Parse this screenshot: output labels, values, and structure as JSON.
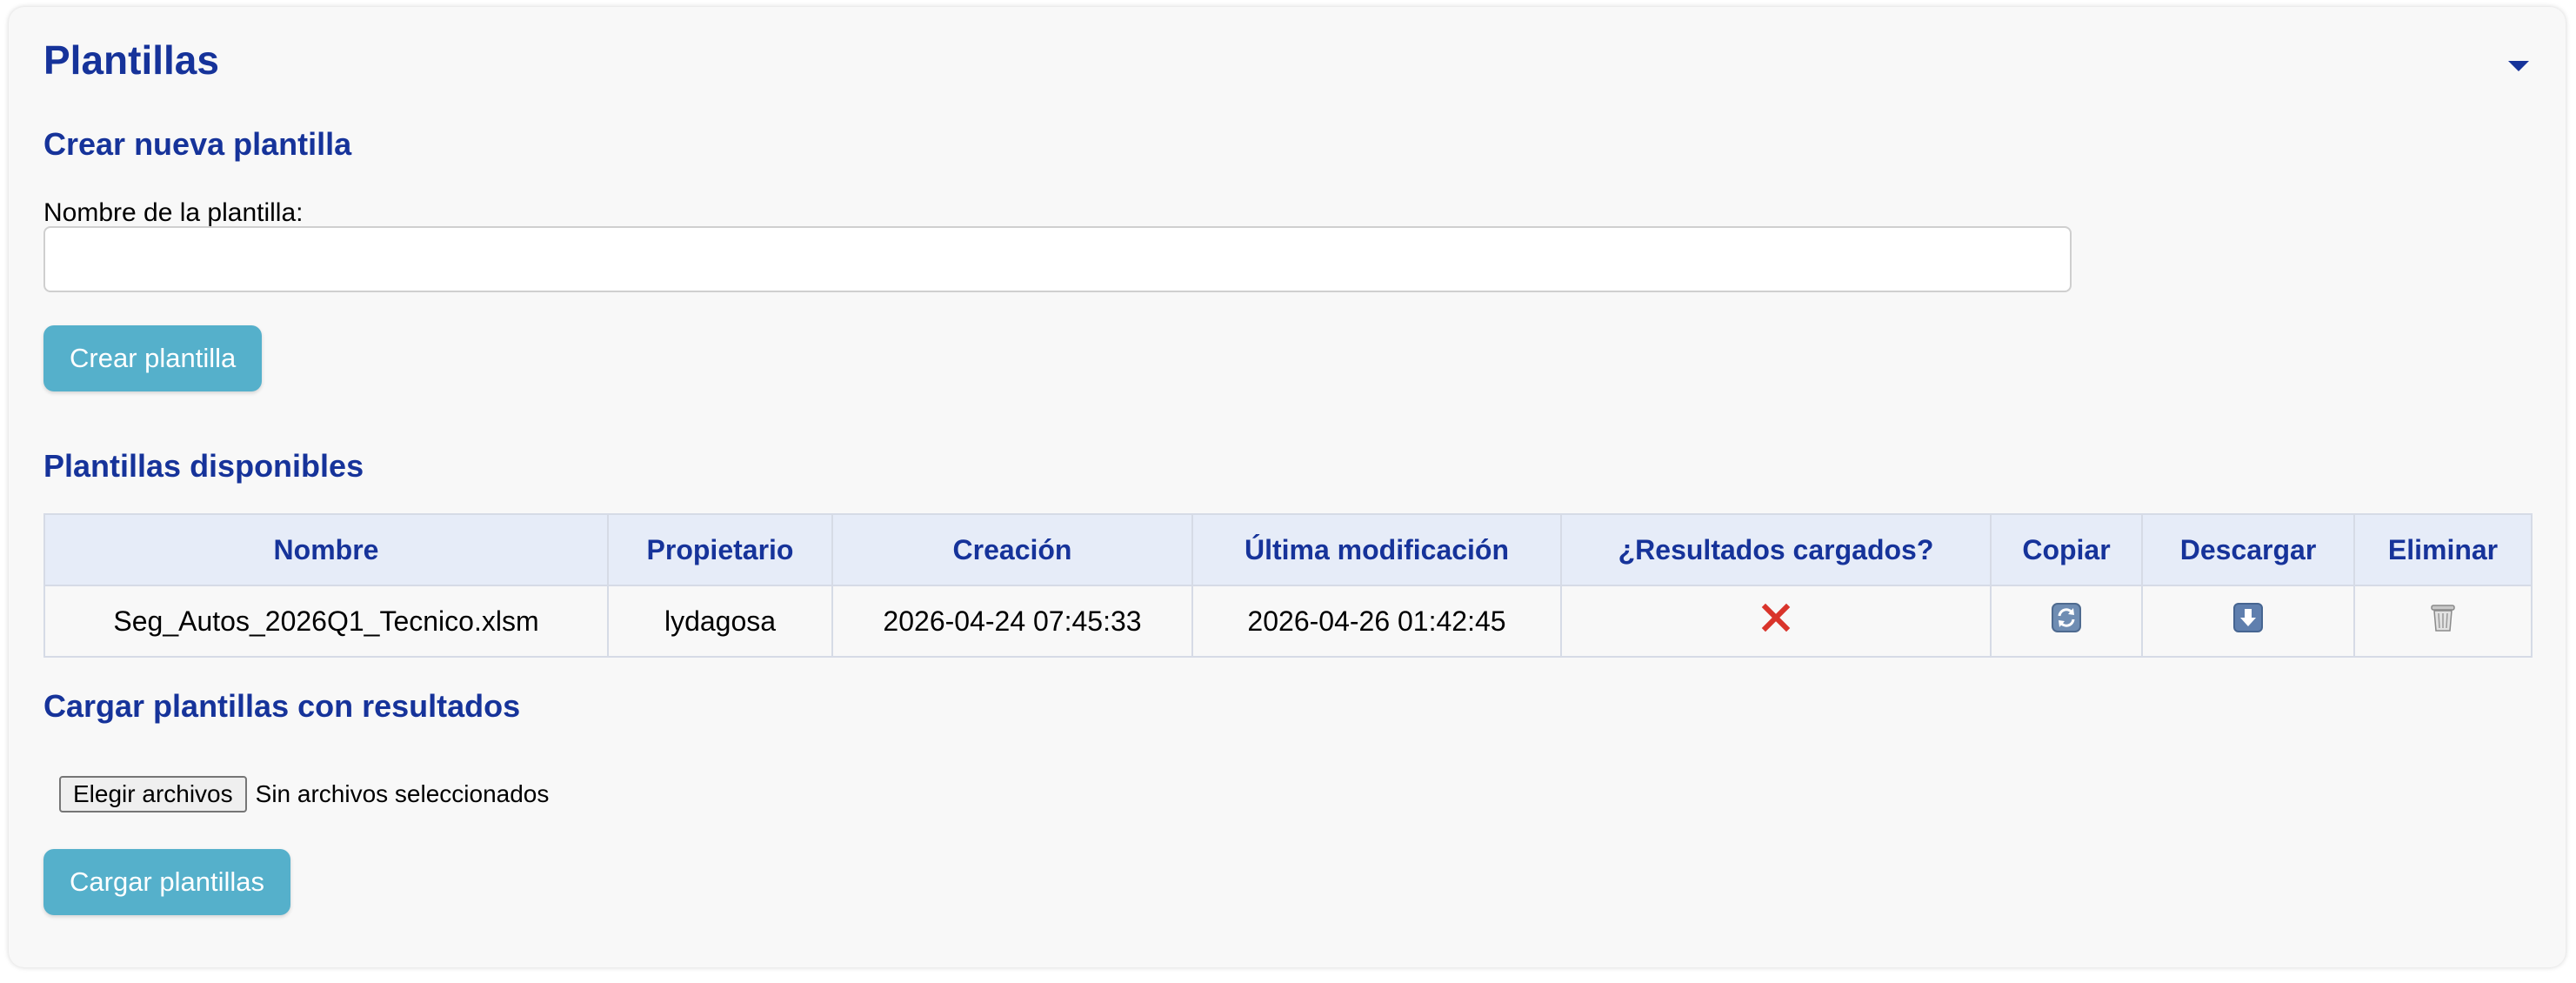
{
  "panel": {
    "title": "Plantillas"
  },
  "create": {
    "heading": "Crear nueva plantilla",
    "name_label": "Nombre de la plantilla:",
    "name_value": "",
    "button_label": "Crear plantilla"
  },
  "available": {
    "heading": "Plantillas disponibles",
    "columns": [
      "Nombre",
      "Propietario",
      "Creación",
      "Última modificación",
      "¿Resultados cargados?",
      "Copiar",
      "Descargar",
      "Eliminar"
    ],
    "rows": [
      {
        "nombre": "Seg_Autos_2026Q1_Tecnico.xlsm",
        "propietario": "lydagosa",
        "creacion": "2026-04-24 07:45:33",
        "modificacion": "2026-04-26 01:42:45",
        "resultados_icon": "red-x-icon",
        "copiar_icon": "refresh-icon",
        "descargar_icon": "download-arrow-icon",
        "eliminar_icon": "trash-icon"
      }
    ]
  },
  "upload": {
    "heading": "Cargar plantillas con resultados",
    "choose_label": "Elegir archivos",
    "status": "Sin archivos seleccionados",
    "button_label": "Cargar plantillas"
  },
  "colors": {
    "heading": "#16339a",
    "button": "#55b0cb",
    "header_bg": "#e6ecf8",
    "error_red": "#d9342b"
  }
}
